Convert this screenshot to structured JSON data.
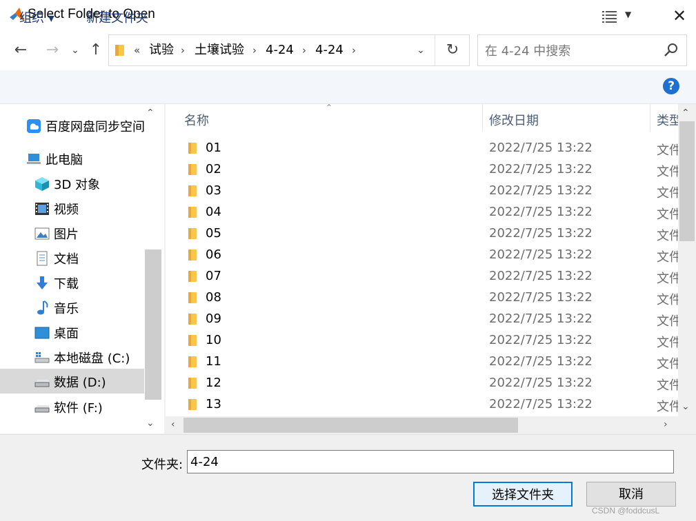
{
  "window": {
    "title": "Select Folder to Open",
    "close_glyph": "✕",
    "app_icon": "matlab-icon"
  },
  "nav": {
    "back_glyph": "←",
    "forward_glyph": "→",
    "recent_glyph": "⌄",
    "up_glyph": "↑",
    "overflow_glyph": "«",
    "breadcrumbs": [
      "试验",
      "土壤试验",
      "4-24",
      "4-24"
    ],
    "refresh_glyph": "↻",
    "search_placeholder": "在 4-24 中搜索"
  },
  "commands": {
    "organize": "组织 ▾",
    "new_folder": "新建文件夹",
    "help": "?"
  },
  "sidebar": {
    "items": [
      {
        "label": "百度网盘同步空间",
        "icon": "baidu-netdisk-icon"
      },
      {
        "label": "此电脑",
        "icon": "this-pc-icon"
      },
      {
        "label": "3D 对象",
        "icon": "3d-objects-icon"
      },
      {
        "label": "视频",
        "icon": "video-icon"
      },
      {
        "label": "图片",
        "icon": "pictures-icon"
      },
      {
        "label": "文档",
        "icon": "documents-icon"
      },
      {
        "label": "下载",
        "icon": "download-icon"
      },
      {
        "label": "音乐",
        "icon": "music-icon"
      },
      {
        "label": "桌面",
        "icon": "desktop-icon"
      },
      {
        "label": "本地磁盘 (C:)",
        "icon": "drive-c-icon"
      },
      {
        "label": "数据 (D:)",
        "icon": "drive-icon",
        "selected": true
      },
      {
        "label": "软件 (F:)",
        "icon": "drive-icon"
      }
    ]
  },
  "list": {
    "headers": {
      "name": "名称",
      "modified": "修改日期",
      "type": "类型"
    },
    "rows": [
      {
        "name": "01",
        "modified": "2022/7/25 13:22",
        "type": "文件"
      },
      {
        "name": "02",
        "modified": "2022/7/25 13:22",
        "type": "文件"
      },
      {
        "name": "03",
        "modified": "2022/7/25 13:22",
        "type": "文件"
      },
      {
        "name": "04",
        "modified": "2022/7/25 13:22",
        "type": "文件"
      },
      {
        "name": "05",
        "modified": "2022/7/25 13:22",
        "type": "文件"
      },
      {
        "name": "06",
        "modified": "2022/7/25 13:22",
        "type": "文件"
      },
      {
        "name": "07",
        "modified": "2022/7/25 13:22",
        "type": "文件"
      },
      {
        "name": "08",
        "modified": "2022/7/25 13:22",
        "type": "文件"
      },
      {
        "name": "09",
        "modified": "2022/7/25 13:22",
        "type": "文件"
      },
      {
        "name": "10",
        "modified": "2022/7/25 13:22",
        "type": "文件"
      },
      {
        "name": "11",
        "modified": "2022/7/25 13:22",
        "type": "文件"
      },
      {
        "name": "12",
        "modified": "2022/7/25 13:22",
        "type": "文件"
      },
      {
        "name": "13",
        "modified": "2022/7/25 13:22",
        "type": "文件"
      }
    ]
  },
  "footer": {
    "folder_label": "文件夹:",
    "folder_value": "4-24",
    "select_button": "选择文件夹",
    "cancel_button": "取消"
  },
  "watermark": "CSDN @foddcusL",
  "colors": {
    "accent": "#0078d7",
    "folder": "#f8c64b",
    "help": "#1f6fce"
  }
}
